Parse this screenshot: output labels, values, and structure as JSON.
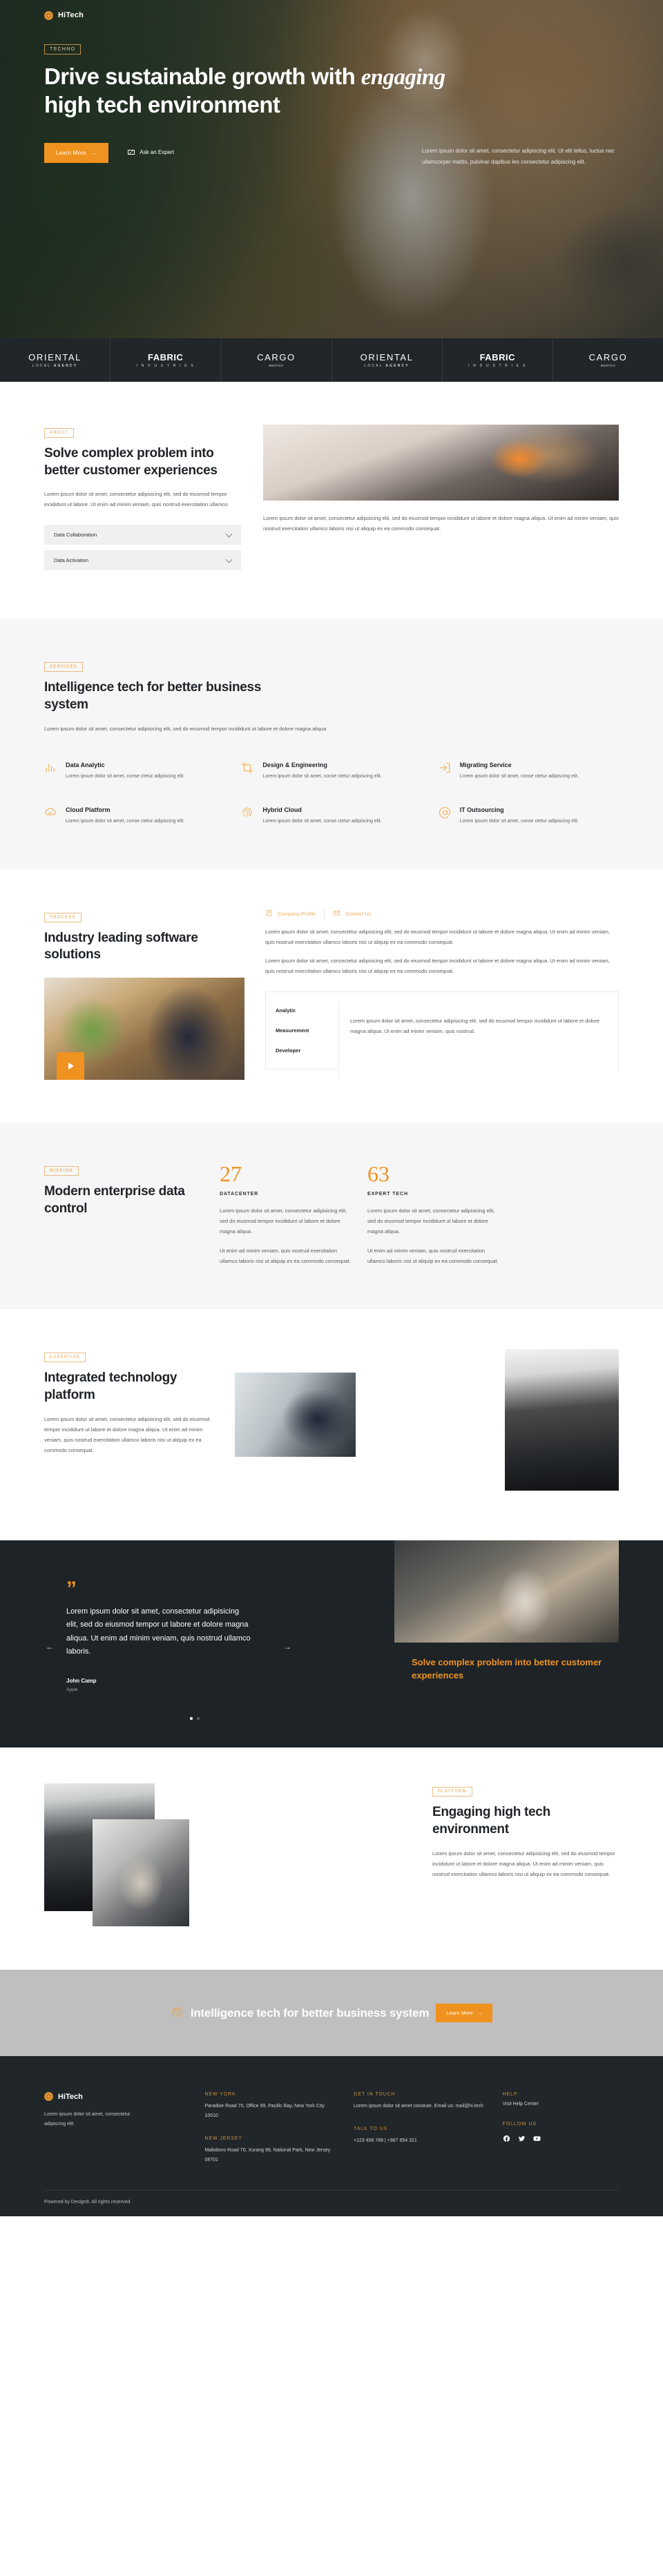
{
  "brand": {
    "name": "HiTech",
    "mark_icon": "fingerprint-logo-icon"
  },
  "hero": {
    "eyebrow": "TECHNO",
    "title_part1": "Drive sustainable growth with ",
    "title_em": "engaging",
    "title_part2": " high tech environment",
    "primary_cta": "Learn More",
    "primary_cta_arrow": "→",
    "secondary_cta": "Ask an Expert",
    "secondary_icon": "envelope-icon",
    "note": "Lorem ipsum dolor sit amet, consectetur adipiscing elit. Ut elit tellus, luctus nec ullamcorper mattis, pulvinar dapibus leo consectetur adipiscing elit."
  },
  "logos": [
    {
      "main": "ORIENTAL",
      "sub_plain": "LOCAL ",
      "sub_bold": "AGENCY",
      "style": "thin"
    },
    {
      "main": "FABRIC",
      "sub_plain": "I N D U S T R I E S",
      "sub_bold": "",
      "style": "bold"
    },
    {
      "main": "CARGO",
      "sub_plain": "metrics",
      "sub_bold": "",
      "style": "italic"
    },
    {
      "main": "ORIENTAL",
      "sub_plain": "LOCAL ",
      "sub_bold": "AGENCY",
      "style": "thin"
    },
    {
      "main": "FABRIC",
      "sub_plain": "I N D U S T R I E S",
      "sub_bold": "",
      "style": "bold"
    },
    {
      "main": "CARGO",
      "sub_plain": "metrics",
      "sub_bold": "",
      "style": "italic"
    }
  ],
  "about": {
    "eyebrow": "ABOUT",
    "title": "Solve complex problem into better customer experiences",
    "body": "Lorem ipsum dolor sit amet, consectetur adipisicing elit, sed do eiusmod tempor incididunt ut labore. Ut enim ad minim veniam, quis nostrud exercitation ullamco.",
    "accordion": [
      {
        "label": "Data Collaboration"
      },
      {
        "label": "Data Activation"
      }
    ],
    "image_alt": "hands-typing-on-laptop-photo",
    "right_body": "Lorem ipsum dolor sit amet, consectetur adipisicing elit, sed do eiusmod tempor incididunt ut labore et dolore magna aliqua. Ut enim ad minim veniam, quis nostrud exercitation ullamco laboris nisi ut aliquip ex ea commodo consequat."
  },
  "services": {
    "eyebrow": "SERVICES",
    "title": "Intelligence tech for better business system",
    "lead": "Lorem ipsum dolor sit amet, consectetur adipisicing elit, sed do eiusmod tempor incididunt ut labore et dolore magna aliqua",
    "items": [
      {
        "icon": "bar-chart-icon",
        "title": "Data Analytic",
        "desc": "Lorem ipsum dolor sit amet, conse ctetur adipiscing elit."
      },
      {
        "icon": "crop-icon",
        "title": "Design & Engineering",
        "desc": "Lorem ipsum dolor sit amet, conse ctetur adipiscing elit."
      },
      {
        "icon": "login-arrow-icon",
        "title": "Migrating Service",
        "desc": "Lorem ipsum dolor sit amet, conse ctetur adipiscing elit."
      },
      {
        "icon": "cloud-check-icon",
        "title": "Cloud Platform",
        "desc": "Lorem ipsum dolor sit amet, conse ctetur adipiscing elit."
      },
      {
        "icon": "fingerprint-icon",
        "title": "Hybrid Cloud",
        "desc": "Lorem ipsum dolor sit amet, conse ctetur adipiscing elit."
      },
      {
        "icon": "at-sign-icon",
        "title": "IT Outsourcing",
        "desc": "Lorem ipsum dolor sit amet, conse ctetur adipiscing elit."
      }
    ]
  },
  "process": {
    "eyebrow": "PROCESS",
    "title": "Industry leading software solutions",
    "video_alt": "man-working-on-laptop-in-cafe-photo",
    "play_button": "play-button",
    "link1": {
      "label": "Company Profile",
      "icon": "document-icon"
    },
    "link2": {
      "label": "Contact Us",
      "icon": "envelope-icon"
    },
    "para1": "Lorem ipsum dolor sit amet, consectetur adipisicing elit, sed do eiusmod tempor incididunt ut labore et dolore magna aliqua. Ut enim ad minim veniam, quis nostrud exercitation ullamco laboris nisi ut aliquip ex ea commodo consequat.",
    "para2": "Lorem ipsum dolor sit amet, consectetur adipisicing elit, sed do eiusmod tempor incididunt ut labore et dolore magna aliqua. Ut enim ad minim veniam, quis nostrud exercitation ullamco laboris nisi ut aliquip ex ea commodo consequat.",
    "tabs": [
      {
        "label": "Analytic",
        "active": true
      },
      {
        "label": "Measurement",
        "active": false
      },
      {
        "label": "Developer",
        "active": false
      }
    ],
    "tab_panel": "Lorem ipsum dolor sit amet, consectetur adipisicing elit, sed do eiusmod tempor incididunt ut labore et dolore magna aliqua. Ut enim ad minim veniam, quis nostrud."
  },
  "mission": {
    "eyebrow": "MISSION",
    "title": "Modern enterprise data control",
    "stats": [
      {
        "number": "27",
        "label": "DATACENTER",
        "p1": "Lorem ipsum dolor sit amet, consectetur adipisicing elit, sed do eiusmod tempor incididunt ut labore et dolore magna aliqua.",
        "p2": "Ut enim ad minim veniam, quis nostrud exercitation ullamco laboris nisi ut aliquip ex ea commodo consequat."
      },
      {
        "number": "63",
        "label": "EXPERT TECH",
        "p1": "Lorem ipsum dolor sit amet, consectetur adipisicing elit, sed do eiusmod tempor incididunt ut labore et dolore magna aliqua.",
        "p2": "Ut enim ad minim veniam, quis nostrud exercitation ullamco laboris nisi ut aliquip ex ea commodo consequat."
      }
    ]
  },
  "expertise": {
    "eyebrow": "EXPERTISE",
    "title": "Integrated technology platform",
    "body": "Lorem ipsum dolor sit amet, consectetur adipisicing elit, sed do eiusmod tempor incididunt ut labore et dolore magna aliqua. Ut enim ad minim veniam, quis nostrud exercitation ullamco laboris nisi ut aliquip ex ea commodo consequat.",
    "image_a_alt": "man-wearing-vr-headset-photo",
    "image_b_alt": "server-room-corridor-photo"
  },
  "testimonial": {
    "quote_mark": "”",
    "quote": "Lorem ipsum dolor sit amet, consectetur adipisicing elit, sed do eiusmod tempor ut labore et dolore magna aliqua. Ut enim ad minim veniam, quis nostrud ullamco laboris.",
    "author": "John Camp",
    "author_company": "Apple",
    "prev_icon": "arrow-left-icon",
    "next_icon": "arrow-right-icon",
    "prev_glyph": "←",
    "next_glyph": "→",
    "slide_count": 2,
    "active_slide": 1,
    "photo_alt": "man-with-phone-photo",
    "cta_title": "Solve complex problem into better customer experiences"
  },
  "platform": {
    "eyebrow": "PLATFORM",
    "title": "Engaging high tech environment",
    "body": "Lorem ipsum dolor sit amet, consectetur adipisicing elit, sed do eiusmod tempor incididunt ut labore et dolore magna aliqua. Ut enim ad minim veniam, quis nostrud exercitation ullamco laboris nisi ut aliquip ex ea commodo consequat.",
    "image_a_alt": "server-room-photo",
    "image_b_alt": "man-with-laptop-photo"
  },
  "cta_band": {
    "icon": "fingerprint-icon",
    "text": "Intelligence tech for better business system",
    "button": "Learn More",
    "button_arrow": "→"
  },
  "footer": {
    "brand": "HiTech",
    "about": "Lorem ipsum dolor sit amet, consectetur adipiscing elit.",
    "columns": [
      {
        "blocks": [
          {
            "head": "NEW YORK",
            "text": "Paradise Road 70, Office 99, Pacific Bay,  New York City 10010"
          },
          {
            "head": "NEW JERSEY",
            "text": "Malioboro Road 70, Xurang 99, National Park, New Jersey 08701"
          }
        ]
      },
      {
        "blocks": [
          {
            "head": "GET IN TOUCH",
            "text": "Lorem ipsum dolor sit amet constute. Email us: mail@hi.tech"
          },
          {
            "head": "TALK TO US",
            "text": "+123 456 789 | +987 654 321"
          }
        ]
      },
      {
        "blocks": [
          {
            "head": "HELP",
            "link": "Visit Help Center"
          },
          {
            "head": "FOLLOW US",
            "socials": [
              "facebook-icon",
              "twitter-icon",
              "youtube-icon"
            ]
          }
        ]
      }
    ],
    "copyright": "Powered by Design8. All rights reserved."
  },
  "colors": {
    "accent": "#f0921f",
    "accent_soft": "#eead5e",
    "dark": "#20262a",
    "band": "#bfbfbf"
  }
}
